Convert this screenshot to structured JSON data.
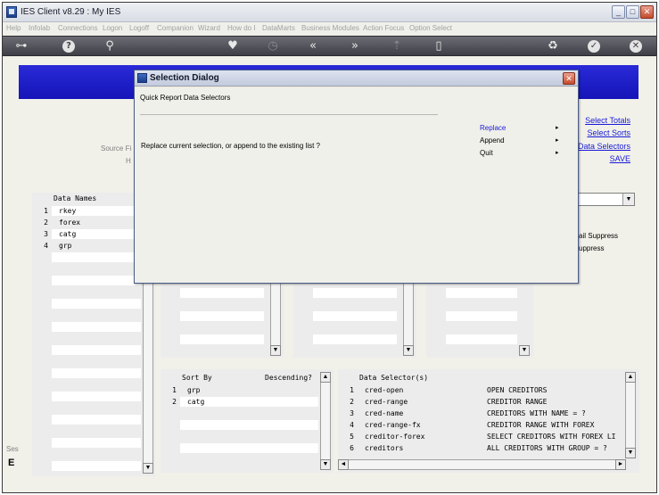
{
  "window": {
    "title": "IES Client v8.29 : My IES",
    "min": "_",
    "max": "□",
    "close": "✕"
  },
  "menu": [
    "Help",
    "Infolab",
    "Connections",
    "Logon",
    "Logoff",
    "Companion",
    "Wizard",
    "How do I",
    "DataMarts",
    "Business Modules",
    "Action Focus",
    "Option Select"
  ],
  "toolbar": [
    {
      "icon": "key-icon",
      "glyph": "⊶"
    },
    {
      "icon": "help-icon",
      "glyph": "?"
    },
    {
      "icon": "search-icon",
      "glyph": "⚲"
    },
    {
      "icon": "heart-icon",
      "glyph": "♥"
    },
    {
      "icon": "clock-icon",
      "glyph": "◷"
    },
    {
      "icon": "rewind-icon",
      "glyph": "«"
    },
    {
      "icon": "forward-icon",
      "glyph": "»"
    },
    {
      "icon": "upload-icon",
      "glyph": "⇡"
    },
    {
      "icon": "document-icon",
      "glyph": "▯"
    },
    {
      "icon": "recycle-icon",
      "glyph": "♻"
    },
    {
      "icon": "check-icon",
      "glyph": "✓"
    },
    {
      "icon": "close-icon",
      "glyph": "✕"
    }
  ],
  "side_links": [
    "Select Totals",
    "Select Sorts",
    "Data Selectors",
    "SAVE"
  ],
  "background_labels": {
    "source": "Source Fi",
    "h": "H",
    "detail_suppress": "ail Suppress",
    "suppress": "uppress",
    "bottom_left": "Ses",
    "bottom_left2": "E"
  },
  "data_names": {
    "header": "Data Names",
    "rows": [
      {
        "n": "1",
        "v": "rkey"
      },
      {
        "n": "2",
        "v": "forex"
      },
      {
        "n": "3",
        "v": "catg"
      },
      {
        "n": "4",
        "v": "grp"
      }
    ]
  },
  "sort_by": {
    "header": "Sort By",
    "header2": "Descending?",
    "rows": [
      {
        "n": "1",
        "v": "grp"
      },
      {
        "n": "2",
        "v": "catg"
      }
    ]
  },
  "data_selectors": {
    "header": "Data Selector(s)",
    "rows": [
      {
        "n": "1",
        "v": "cred-open",
        "d": "OPEN CREDITORS"
      },
      {
        "n": "2",
        "v": "cred-range",
        "d": "CREDITOR RANGE"
      },
      {
        "n": "3",
        "v": "cred-name",
        "d": "CREDITORS WITH NAME = ?"
      },
      {
        "n": "4",
        "v": "cred-range-fx",
        "d": "CREDITOR RANGE WITH FOREX"
      },
      {
        "n": "5",
        "v": "creditor-forex",
        "d": "SELECT CREDITORS WITH FOREX LI"
      },
      {
        "n": "6",
        "v": "creditors",
        "d": "ALL CREDITORS WITH GROUP = ?"
      }
    ]
  },
  "dialog": {
    "title": "Selection Dialog",
    "subtitle": "Quick Report Data Selectors",
    "message": "Replace current selection, or append to the existing list ?",
    "options": [
      {
        "label": "Replace",
        "arrow": "▸"
      },
      {
        "label": "Append",
        "arrow": "▸"
      },
      {
        "label": "Quit",
        "arrow": "▸"
      }
    ],
    "close": "✕"
  },
  "scroll": {
    "up": "▲",
    "down": "▼",
    "left": "◄",
    "right": "►"
  }
}
